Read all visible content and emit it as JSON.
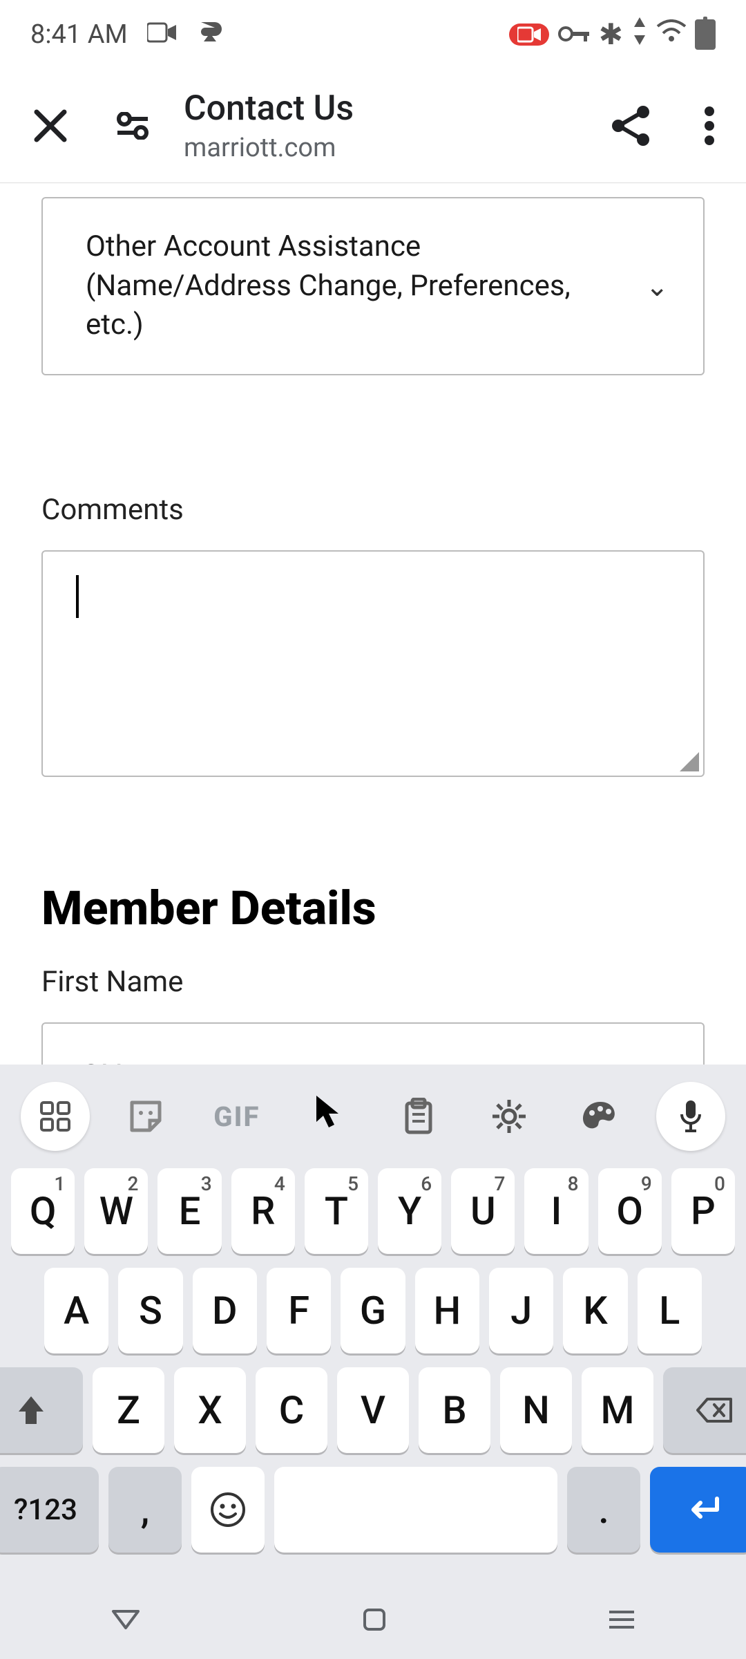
{
  "status": {
    "time": "8:41 AM"
  },
  "header": {
    "title": "Contact Us",
    "subtitle": "marriott.com"
  },
  "form": {
    "topic_selected": "Other Account Assistance (Name/Address Change, Preferences, etc.)",
    "comments_label": "Comments",
    "comments_value": "",
    "section_heading": "Member Details",
    "first_name_label": "First Name",
    "first_name_value": "SHANE"
  },
  "keyboard": {
    "strip_gif": "GIF",
    "row1": [
      {
        "main": "Q",
        "sup": "1"
      },
      {
        "main": "W",
        "sup": "2"
      },
      {
        "main": "E",
        "sup": "3"
      },
      {
        "main": "R",
        "sup": "4"
      },
      {
        "main": "T",
        "sup": "5"
      },
      {
        "main": "Y",
        "sup": "6"
      },
      {
        "main": "U",
        "sup": "7"
      },
      {
        "main": "I",
        "sup": "8"
      },
      {
        "main": "O",
        "sup": "9"
      },
      {
        "main": "P",
        "sup": "0"
      }
    ],
    "row2": [
      "A",
      "S",
      "D",
      "F",
      "G",
      "H",
      "J",
      "K",
      "L"
    ],
    "row3": [
      "Z",
      "X",
      "C",
      "V",
      "B",
      "N",
      "M"
    ],
    "sym_label": "?123",
    "comma": ",",
    "dot": ".",
    "emoji": "☺",
    "enter": "↵"
  }
}
